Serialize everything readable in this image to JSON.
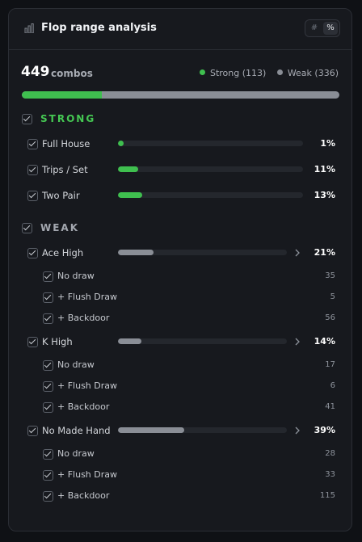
{
  "header": {
    "title": "Flop range analysis",
    "toggle": {
      "count_label": "#",
      "percent_label": "%",
      "active": "percent"
    }
  },
  "summary": {
    "total": "449",
    "total_label": "combos",
    "legend": [
      {
        "name": "Strong (113)",
        "color": "#3fbf4f"
      },
      {
        "name": "Weak (336)",
        "color": "#8a8e96"
      }
    ],
    "strong_fraction": 0.2517
  },
  "colors": {
    "strong": "#3fbf4f",
    "weak": "#8a8e96",
    "section_strong": "#45c853",
    "section_weak": "#a3a7af"
  },
  "sections": {
    "strong": {
      "title": "STRONG",
      "items": [
        {
          "label": "Full House",
          "pct": "1%",
          "value": 1
        },
        {
          "label": "Trips / Set",
          "pct": "11%",
          "value": 11
        },
        {
          "label": "Two Pair",
          "pct": "13%",
          "value": 13
        }
      ]
    },
    "weak": {
      "title": "WEAK",
      "items": [
        {
          "label": "Ace High",
          "pct": "21%",
          "value": 21,
          "subs": [
            {
              "label": "No draw",
              "count": "35"
            },
            {
              "label": "+ Flush Draw",
              "count": "5"
            },
            {
              "label": "+ Backdoor",
              "count": "56"
            }
          ]
        },
        {
          "label": "K High",
          "pct": "14%",
          "value": 14,
          "subs": [
            {
              "label": "No draw",
              "count": "17"
            },
            {
              "label": "+ Flush Draw",
              "count": "6"
            },
            {
              "label": "+ Backdoor",
              "count": "41"
            }
          ]
        },
        {
          "label": "No Made Hand",
          "pct": "39%",
          "value": 39,
          "subs": [
            {
              "label": "No draw",
              "count": "28"
            },
            {
              "label": "+ Flush Draw",
              "count": "33"
            },
            {
              "label": "+ Backdoor",
              "count": "115"
            }
          ]
        }
      ]
    }
  }
}
